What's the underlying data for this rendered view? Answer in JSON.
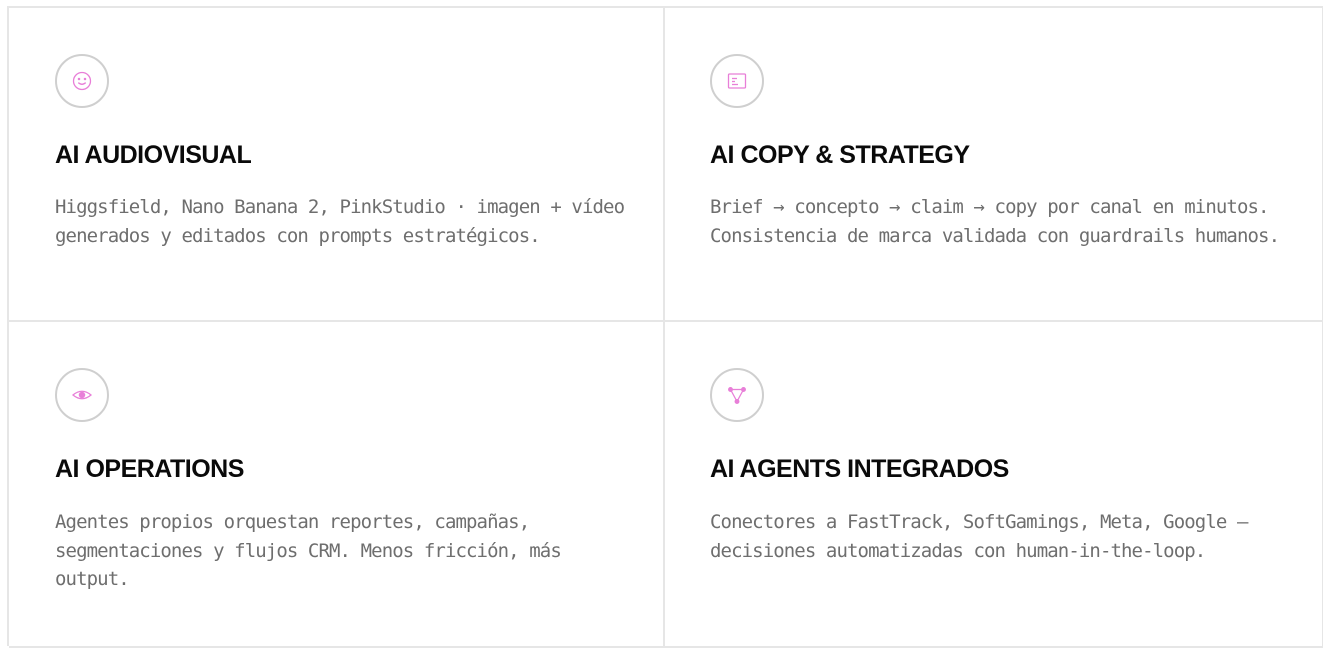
{
  "accent_color": "#e87fd8",
  "cards": [
    {
      "icon": "smiley-icon",
      "title": "AI AUDIOVISUAL",
      "description": "Higgsfield, Nano Banana 2, PinkStudio · imagen + vídeo generados y editados con prompts estratégicos."
    },
    {
      "icon": "document-icon",
      "title": "AI COPY & STRATEGY",
      "description": "Brief → concepto → claim → copy por canal en minutos. Consistencia de marca validada con guardrails humanos."
    },
    {
      "icon": "eye-icon",
      "title": "AI OPERATIONS",
      "description": "Agentes propios orquestan reportes, campañas, segmentaciones y flujos CRM. Menos fricción, más output."
    },
    {
      "icon": "network-icon",
      "title": "AI AGENTS INTEGRADOS",
      "description": "Conectores a FastTrack, SoftGamings, Meta, Google — decisiones automatizadas con human-in-the-loop."
    }
  ]
}
